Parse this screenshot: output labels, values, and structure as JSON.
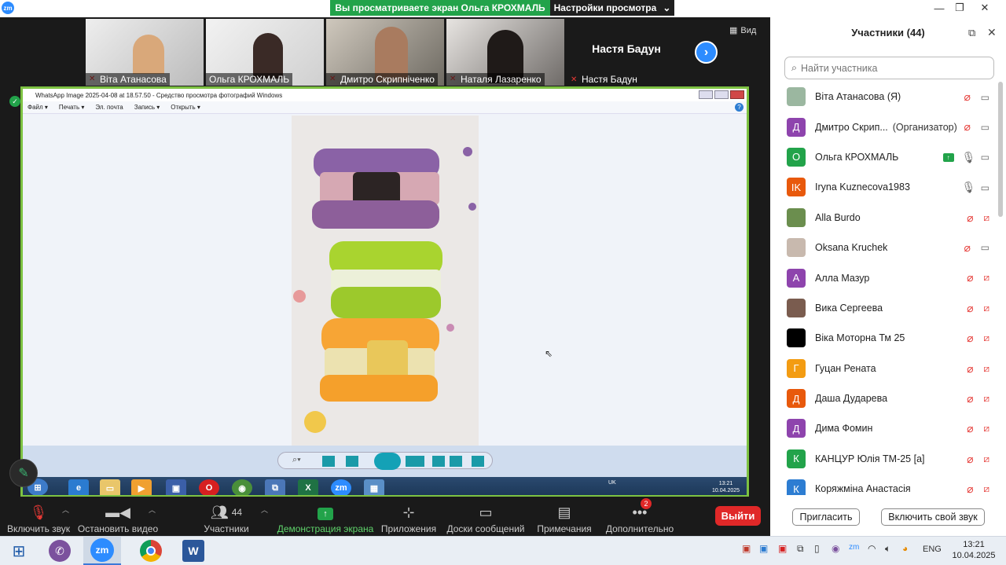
{
  "titlebar": {
    "share_banner": "Вы просматриваете экран Ольга КРОХМАЛЬ",
    "view_settings": "Настройки просмотра",
    "zoom_logo": "zm"
  },
  "gallery": {
    "view_button": "Вид",
    "tiles": [
      {
        "name": "Віта Атанасова",
        "muted": true,
        "color": "#cfcfcf"
      },
      {
        "name": "Ольга КРОХМАЛЬ",
        "muted": false,
        "color": "#d9d5cf"
      },
      {
        "name": "Дмитро Скрипніченко",
        "muted": true,
        "color": "#8d8a84"
      },
      {
        "name": "Наталя Лазаренко",
        "muted": true,
        "color": "#6f6b68"
      }
    ],
    "active_speaker": "Настя Бадун",
    "active_speaker_label": "Настя Бадун"
  },
  "shared_screen": {
    "window_title": "WhatsApp Image 2025-04-08 at 18.57.50 - Средство просмотра фотографий Windows",
    "menu": [
      "Файл ▾",
      "Печать ▾",
      "Эл. почта",
      "Запись ▾",
      "Открыть ▾"
    ],
    "tray_lang": "UK",
    "tray_time": "13:21",
    "tray_date": "10.04.2025"
  },
  "toolbar": {
    "unmute": "Включить звук",
    "start_video": "Остановить видео",
    "participants": "Участники",
    "participants_count": "44",
    "share_screen": "Демонстрация экрана",
    "apps": "Приложения",
    "whiteboards": "Доски сообщений",
    "notes": "Примечания",
    "more": "Дополнительно",
    "more_badge": "2",
    "leave": "Выйти"
  },
  "panel": {
    "title": "Участники (44)",
    "search_placeholder": "Найти участника",
    "invite": "Пригласить",
    "unmute_self": "Включить свой звук",
    "participants": [
      {
        "name": "Віта Атанасова (Я)",
        "role": "",
        "initial": "",
        "color": "#9bb7a0",
        "mic": "off",
        "cam": "on",
        "share": false
      },
      {
        "name": "Дмитро Скрип...",
        "role": "(Организатор)",
        "initial": "Д",
        "color": "#8e44ad",
        "mic": "off",
        "cam": "on",
        "share": false
      },
      {
        "name": "Ольга КРОХМАЛЬ",
        "role": "",
        "initial": "О",
        "color": "#22a34a",
        "mic": "on",
        "cam": "on",
        "share": true
      },
      {
        "name": "Iryna Kuznecova1983",
        "role": "",
        "initial": "IK",
        "color": "#e8590c",
        "mic": "on",
        "cam": "on",
        "share": false
      },
      {
        "name": "Alla Burdo",
        "role": "",
        "initial": "",
        "color": "#6b8e4e",
        "mic": "off",
        "cam": "off",
        "share": false
      },
      {
        "name": "Oksana Kruchek",
        "role": "",
        "initial": "",
        "color": "#c8b9ae",
        "mic": "off",
        "cam": "on",
        "share": false
      },
      {
        "name": "Алла Мазур",
        "role": "",
        "initial": "А",
        "color": "#8e44ad",
        "mic": "off",
        "cam": "off",
        "share": false
      },
      {
        "name": "Вика Сергеева",
        "role": "",
        "initial": "",
        "color": "#7a5c4f",
        "mic": "off",
        "cam": "off",
        "share": false
      },
      {
        "name": "Віка Моторна Тм 25",
        "role": "",
        "initial": "",
        "color": "#000000",
        "mic": "off",
        "cam": "off",
        "share": false
      },
      {
        "name": "Гуцан Рената",
        "role": "",
        "initial": "Г",
        "color": "#f39c12",
        "mic": "off",
        "cam": "off",
        "share": false
      },
      {
        "name": "Даша Дударева",
        "role": "",
        "initial": "Д",
        "color": "#e8590c",
        "mic": "off",
        "cam": "off",
        "share": false
      },
      {
        "name": "Дима Фомин",
        "role": "",
        "initial": "Д",
        "color": "#8e44ad",
        "mic": "off",
        "cam": "off",
        "share": false
      },
      {
        "name": "КАНЦУР Юлія ТМ-25 [а]",
        "role": "",
        "initial": "К",
        "color": "#22a34a",
        "mic": "off",
        "cam": "off",
        "share": false
      },
      {
        "name": "Коряжміна Анастасія",
        "role": "",
        "initial": "К",
        "color": "#2d7dd2",
        "mic": "off",
        "cam": "off",
        "share": false
      }
    ]
  },
  "taskbar": {
    "lang": "ENG",
    "time": "13:21",
    "date": "10.04.2025",
    "zoom_label": "zm"
  }
}
